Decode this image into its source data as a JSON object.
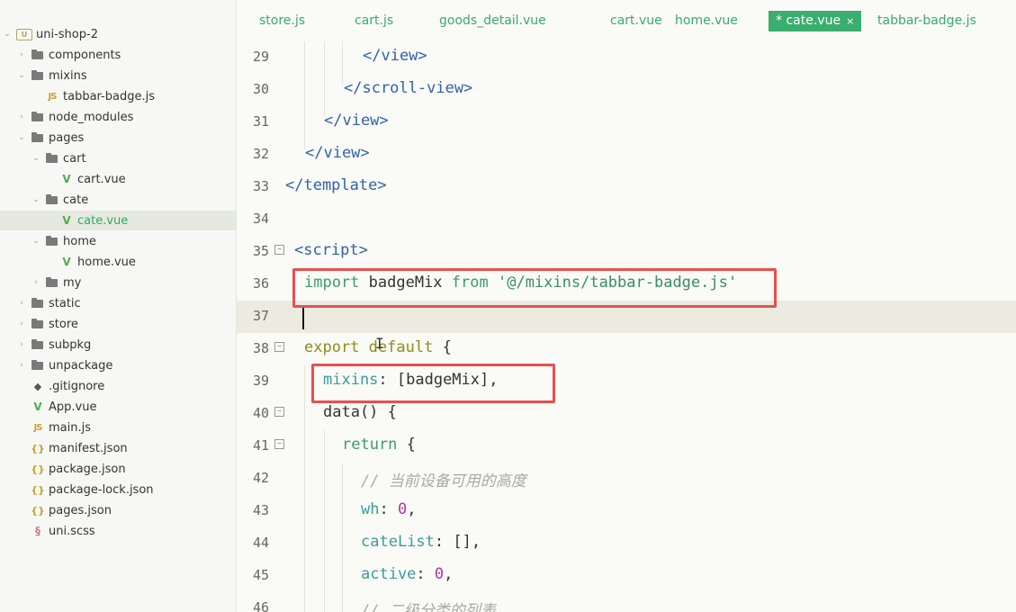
{
  "sidebar": {
    "project_name": "uni-shop-2",
    "items": [
      {
        "label": "components",
        "icon": "folder-icon"
      },
      {
        "label": "mixins",
        "icon": "folder-icon"
      },
      {
        "label": "tabbar-badge.js",
        "icon": "js-file-icon"
      },
      {
        "label": "node_modules",
        "icon": "folder-icon"
      },
      {
        "label": "pages",
        "icon": "folder-icon"
      },
      {
        "label": "cart",
        "icon": "folder-icon"
      },
      {
        "label": "cart.vue",
        "icon": "vue-file-icon"
      },
      {
        "label": "cate",
        "icon": "folder-icon"
      },
      {
        "label": "cate.vue",
        "icon": "vue-file-icon"
      },
      {
        "label": "home",
        "icon": "folder-icon"
      },
      {
        "label": "home.vue",
        "icon": "vue-file-icon"
      },
      {
        "label": "my",
        "icon": "folder-icon"
      },
      {
        "label": "static",
        "icon": "folder-icon"
      },
      {
        "label": "store",
        "icon": "folder-icon"
      },
      {
        "label": "subpkg",
        "icon": "folder-icon"
      },
      {
        "label": "unpackage",
        "icon": "folder-icon"
      },
      {
        "label": ".gitignore",
        "icon": "git-file-icon"
      },
      {
        "label": "App.vue",
        "icon": "vue-file-icon"
      },
      {
        "label": "main.js",
        "icon": "js-file-icon"
      },
      {
        "label": "manifest.json",
        "icon": "json-file-icon"
      },
      {
        "label": "package.json",
        "icon": "json-file-icon"
      },
      {
        "label": "package-lock.json",
        "icon": "json-file-icon"
      },
      {
        "label": "pages.json",
        "icon": "json-file-icon"
      },
      {
        "label": "uni.scss",
        "icon": "scss-file-icon"
      }
    ]
  },
  "tabs": [
    {
      "label": "store.js"
    },
    {
      "label": "cart.js"
    },
    {
      "label": "goods_detail.vue"
    },
    {
      "label": "cart.vue"
    },
    {
      "label": "home.vue"
    },
    {
      "label": "* cate.vue",
      "close": "×"
    },
    {
      "label": "tabbar-badge.js"
    }
  ],
  "editor": {
    "lines": [
      {
        "n": "29",
        "tokens": [
          {
            "t": "</view>",
            "c": "tag"
          }
        ]
      },
      {
        "n": "30",
        "tokens": [
          {
            "t": "</scroll-view>",
            "c": "tag"
          }
        ]
      },
      {
        "n": "31",
        "tokens": [
          {
            "t": "</view>",
            "c": "tag"
          }
        ]
      },
      {
        "n": "32",
        "tokens": [
          {
            "t": "</view>",
            "c": "tag"
          }
        ]
      },
      {
        "n": "33",
        "tokens": [
          {
            "t": "</template>",
            "c": "tag"
          }
        ]
      },
      {
        "n": "34",
        "tokens": []
      },
      {
        "n": "35",
        "tokens": [
          {
            "t": "<script>",
            "c": "tag"
          }
        ]
      },
      {
        "n": "36",
        "tokens": [
          {
            "t": "import",
            "c": "kw-imp"
          },
          {
            "t": " badgeMix ",
            "c": "plain"
          },
          {
            "t": "from",
            "c": "kw-imp"
          },
          {
            "t": " ",
            "c": "plain"
          },
          {
            "t": "'@/mixins/tabbar-badge.js'",
            "c": "str"
          }
        ]
      },
      {
        "n": "37",
        "tokens": []
      },
      {
        "n": "38",
        "tokens": [
          {
            "t": "export",
            "c": "kw-exp"
          },
          {
            "t": " ",
            "c": "plain"
          },
          {
            "t": "default",
            "c": "kw-exp"
          },
          {
            "t": " {",
            "c": "plain"
          }
        ]
      },
      {
        "n": "39",
        "tokens": [
          {
            "t": "mixins",
            "c": "prop"
          },
          {
            "t": ": [badgeMix],",
            "c": "plain"
          }
        ]
      },
      {
        "n": "40",
        "tokens": [
          {
            "t": "data() {",
            "c": "plain"
          }
        ]
      },
      {
        "n": "41",
        "tokens": [
          {
            "t": "return",
            "c": "kw-imp"
          },
          {
            "t": " {",
            "c": "plain"
          }
        ]
      },
      {
        "n": "42",
        "tokens": [
          {
            "t": "// 当前设备可用的高度",
            "c": "cmt"
          }
        ]
      },
      {
        "n": "43",
        "tokens": [
          {
            "t": "wh",
            "c": "prop"
          },
          {
            "t": ": ",
            "c": "plain"
          },
          {
            "t": "0",
            "c": "num"
          },
          {
            "t": ",",
            "c": "plain"
          }
        ]
      },
      {
        "n": "44",
        "tokens": [
          {
            "t": "cateList",
            "c": "prop"
          },
          {
            "t": ": [],",
            "c": "plain"
          }
        ]
      },
      {
        "n": "45",
        "tokens": [
          {
            "t": "active",
            "c": "prop"
          },
          {
            "t": ": ",
            "c": "plain"
          },
          {
            "t": "0",
            "c": "num"
          },
          {
            "t": ",",
            "c": "plain"
          }
        ]
      },
      {
        "n": "46",
        "tokens": [
          {
            "t": "// 二级分类的列表",
            "c": "cmt"
          }
        ]
      }
    ]
  }
}
